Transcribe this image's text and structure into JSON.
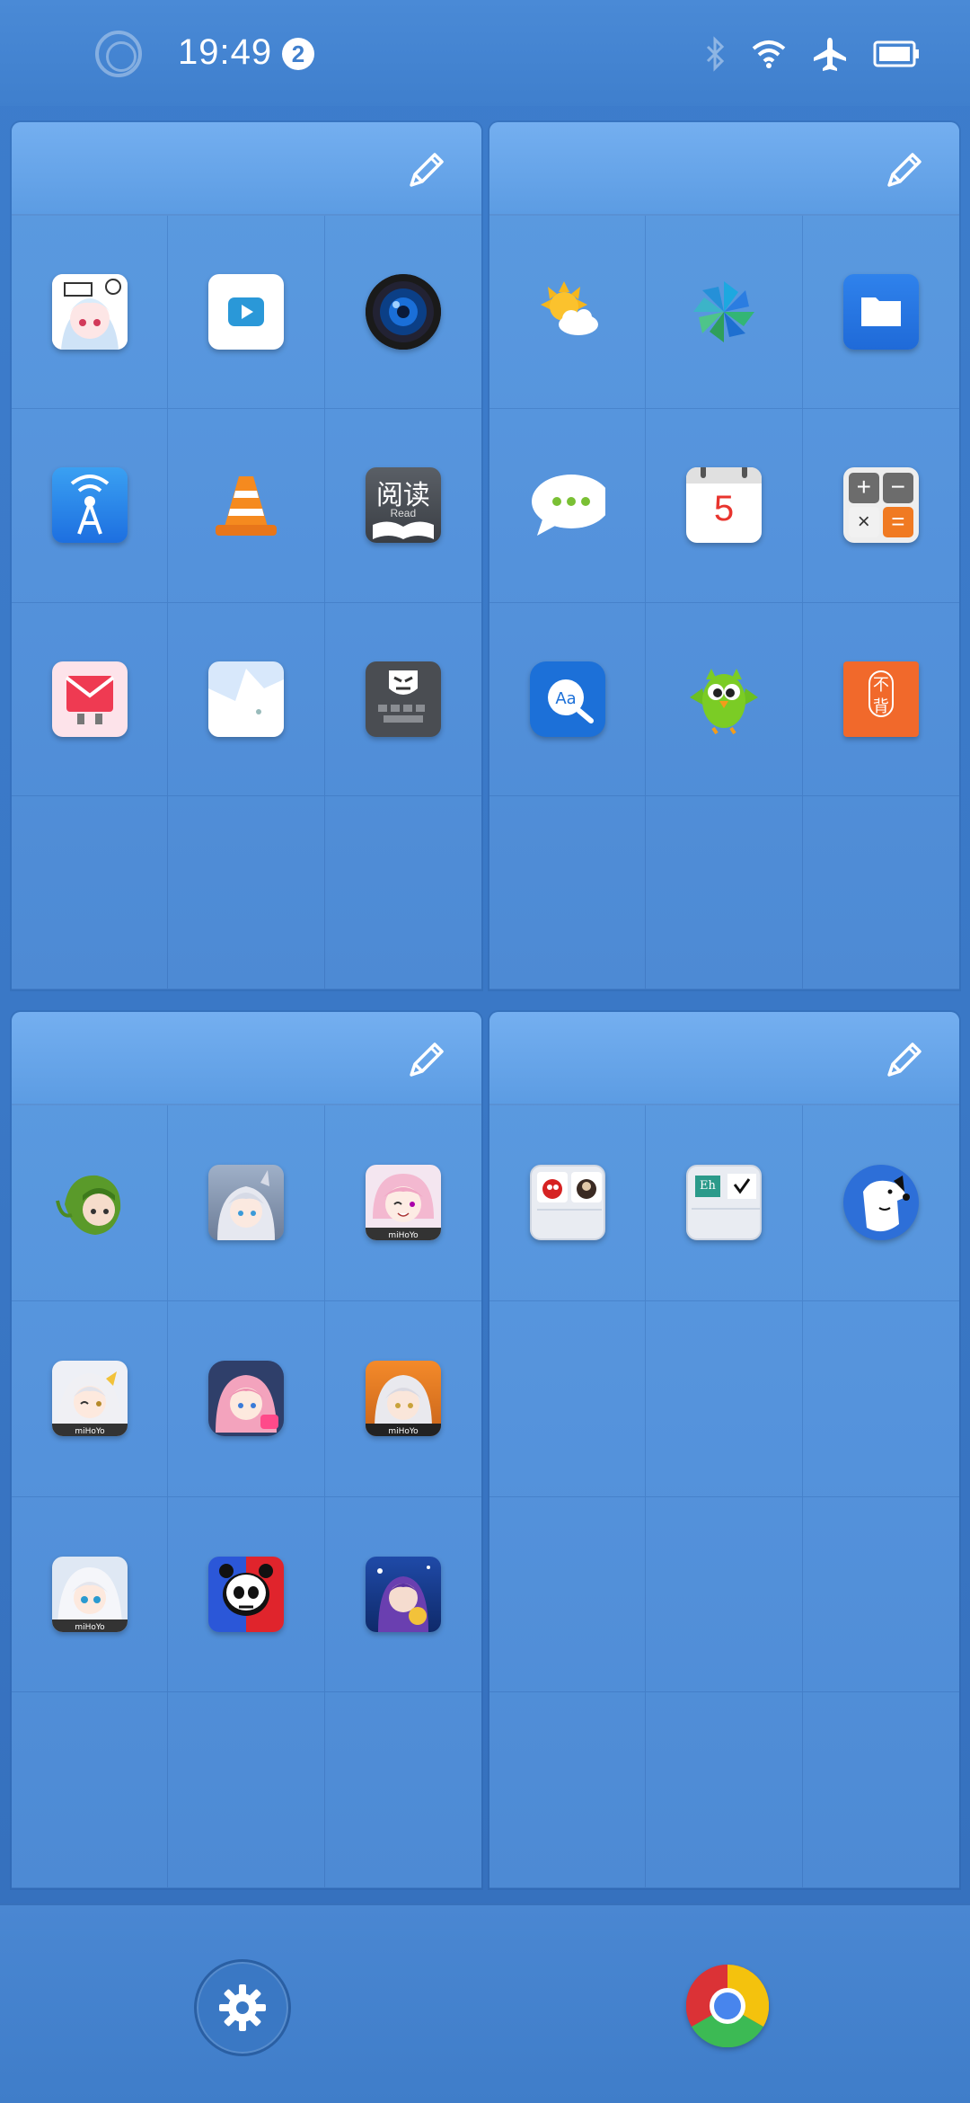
{
  "status_bar": {
    "time": "19:49",
    "notification_count": "2",
    "icons": [
      "bluetooth-icon",
      "wifi-icon",
      "airplane-mode-icon",
      "battery-icon"
    ]
  },
  "folders": [
    {
      "id": "top-left",
      "apps": [
        "anime-character-app",
        "video-player",
        "camera-lens-app",
        "podcast-broadcast-app",
        "vlc-media-player",
        "reading-app",
        "mail-app",
        "white-cat-app",
        "keyboard-app"
      ]
    },
    {
      "id": "top-right",
      "apps": [
        "weather",
        "photos",
        "files",
        "messages",
        "calendar",
        "calculator",
        "dictionary",
        "duolingo",
        "notebook-app"
      ]
    },
    {
      "id": "bottom-left",
      "apps": [
        "green-hair-character-app",
        "silver-hair-character-app",
        "pink-hair-character-app",
        "honkai-character-app",
        "pink-twin-tail-character-app",
        "white-hair-character-app",
        "white-hair-blue-eye-character-app",
        "skull-game-app",
        "purple-hair-character-app"
      ]
    },
    {
      "id": "bottom-right",
      "apps": [
        "angry-birds-folder",
        "eh-folder",
        "white-dog-app"
      ]
    }
  ],
  "calendar_day": "5",
  "reading_app_text": "阅读",
  "reading_app_sub": "Read",
  "notebook_app_text_top": "不",
  "notebook_app_text_bottom": "背",
  "eh_label": "Eh",
  "dock": {
    "items": [
      "settings",
      "chrome"
    ]
  },
  "colors": {
    "panel": "#5593dc",
    "header": "#6aa8ec",
    "background": "#3a78c6"
  }
}
